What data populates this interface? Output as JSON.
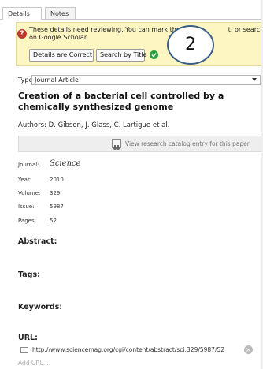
{
  "tabs": [
    {
      "label": "Details"
    },
    {
      "label": "Notes"
    }
  ],
  "notice": {
    "line1": "These details need reviewing. You can mark the",
    "line1b": "t, or search by tit",
    "line2": "on Google Scholar.",
    "correct_label": "Details are Correct",
    "search_label": "Search by Title"
  },
  "step_badge": "2",
  "type": {
    "label": "Type:",
    "value": "Journal Article"
  },
  "title": "Creation of a bacterial cell controlled by a chemically synthesized genome",
  "authors": {
    "label": "Authors:",
    "value": "D. Gibson, J. Glass, C. Lartigue et al."
  },
  "catalog_label": "View research catalog entry for this paper",
  "fields": {
    "journal": {
      "label": "Journal:",
      "value": "Science"
    },
    "year": {
      "label": "Year:",
      "value": "2010"
    },
    "volume": {
      "label": "Volume:",
      "value": "329"
    },
    "issue": {
      "label": "Issue:",
      "value": "5987"
    },
    "pages": {
      "label": "Pages:",
      "value": "52"
    }
  },
  "sections": {
    "abstract": "Abstract:",
    "tags": "Tags:",
    "keywords": "Keywords:",
    "url": "URL:"
  },
  "url_value": "http://www.sciencemag.org/cgi/content/abstract/sci;329/5987/52",
  "add_url": "Add URL...",
  "colors": {
    "notice_bg": "#fdf6c3",
    "warning": "#c0392b",
    "ok": "#2ea043",
    "badge_border": "#3b5f86"
  }
}
